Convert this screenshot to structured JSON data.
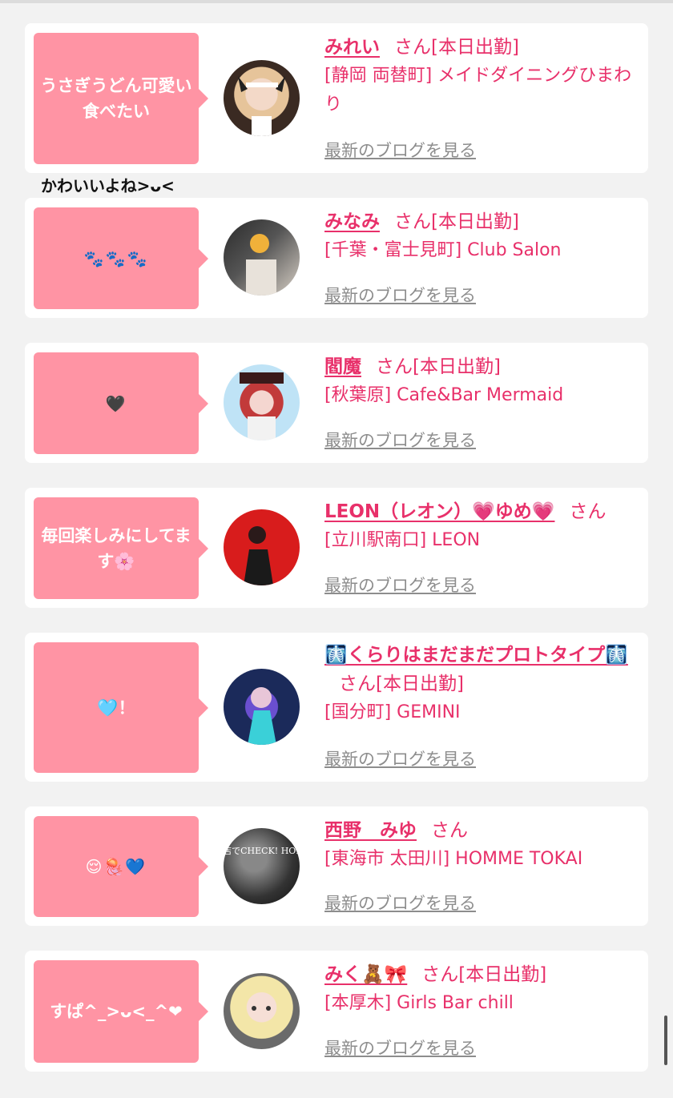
{
  "colors": {
    "accent": "#e8306a",
    "bubble": "#ff94a4",
    "muted": "#8d8d8d"
  },
  "extra_comment": "かわいいよね>ᴗ<",
  "cards": [
    {
      "comment": "うさぎうどん可愛い食べたい",
      "name": "みれい",
      "suffix": "さん[本日出勤]",
      "shop": "[静岡 両替町] メイドダイニングひまわり",
      "blog": "最新のブログを見る"
    },
    {
      "comment": "🐾🐾🐾",
      "name": "みなみ",
      "suffix": "さん[本日出勤]",
      "shop": "[千葉・富士見町] Club Salon",
      "blog": "最新のブログを見る"
    },
    {
      "comment": "🖤",
      "name": "閻魔",
      "suffix": "さん[本日出勤]",
      "shop": "[秋葉原] Cafe&Bar Mermaid",
      "blog": "最新のブログを見る"
    },
    {
      "comment": "毎回楽しみにしてます🌸",
      "name": "LEON（レオン）💗ゆめ💗",
      "suffix": "さん",
      "shop": "[立川駅南口] LEON",
      "blog": "最新のブログを見る"
    },
    {
      "comment": "🩵！",
      "name": "🩻くらりはまだまだプロトタイプ🩻",
      "suffix": "さん[本日出勤]",
      "shop": "[国分町] GEMINI",
      "blog": "最新のブログを見る"
    },
    {
      "comment": "😌🪼💙",
      "name": "西野　みゆ",
      "suffix": "さん",
      "shop": "[東海市 太田川] HOMME TOKAI",
      "blog": "最新のブログを見る",
      "avatar_text": "顔出しNG お店でCHECK! HOMME TOKAI"
    },
    {
      "comment": "すぱ^_>ᴗ<_^❤",
      "name": "みく🧸🎀",
      "suffix": "さん[本日出勤]",
      "shop": "[本厚木] Girls Bar chill",
      "blog": "最新のブログを見る"
    }
  ]
}
